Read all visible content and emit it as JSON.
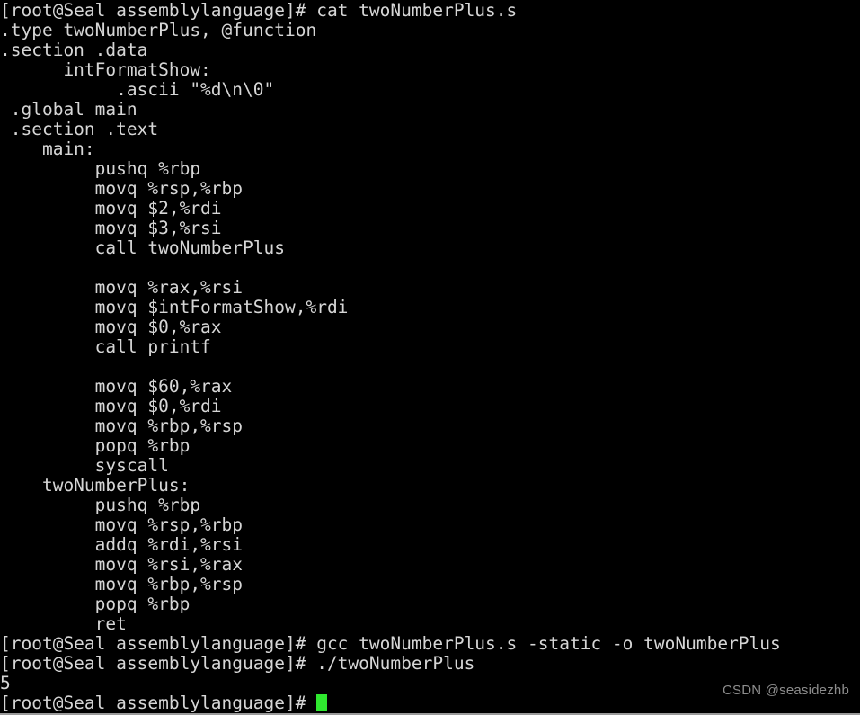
{
  "terminal": {
    "background_color": "#000000",
    "foreground_color": "#d6d6d6",
    "cursor_color": "#2fe82f",
    "prompt": "[root@Seal assemblylanguage]# ",
    "lines": [
      {
        "type": "prompt",
        "prompt": "[root@Seal assemblylanguage]# ",
        "command": "cat twoNumberPlus.s"
      },
      {
        "type": "output",
        "text": ".type twoNumberPlus, @function"
      },
      {
        "type": "output",
        "text": ".section .data"
      },
      {
        "type": "output",
        "text": "      intFormatShow:"
      },
      {
        "type": "output",
        "text": "           .ascii \"%d\\n\\0\""
      },
      {
        "type": "output",
        "text": " .global main"
      },
      {
        "type": "output",
        "text": " .section .text"
      },
      {
        "type": "output",
        "text": "    main:"
      },
      {
        "type": "output",
        "text": "         pushq %rbp"
      },
      {
        "type": "output",
        "text": "         movq %rsp,%rbp"
      },
      {
        "type": "output",
        "text": "         movq $2,%rdi"
      },
      {
        "type": "output",
        "text": "         movq $3,%rsi"
      },
      {
        "type": "output",
        "text": "         call twoNumberPlus"
      },
      {
        "type": "output",
        "text": ""
      },
      {
        "type": "output",
        "text": "         movq %rax,%rsi"
      },
      {
        "type": "output",
        "text": "         movq $intFormatShow,%rdi"
      },
      {
        "type": "output",
        "text": "         movq $0,%rax"
      },
      {
        "type": "output",
        "text": "         call printf"
      },
      {
        "type": "output",
        "text": ""
      },
      {
        "type": "output",
        "text": "         movq $60,%rax"
      },
      {
        "type": "output",
        "text": "         movq $0,%rdi"
      },
      {
        "type": "output",
        "text": "         movq %rbp,%rsp"
      },
      {
        "type": "output",
        "text": "         popq %rbp"
      },
      {
        "type": "output",
        "text": "         syscall"
      },
      {
        "type": "output",
        "text": "    twoNumberPlus:"
      },
      {
        "type": "output",
        "text": "         pushq %rbp"
      },
      {
        "type": "output",
        "text": "         movq %rsp,%rbp"
      },
      {
        "type": "output",
        "text": "         addq %rdi,%rsi"
      },
      {
        "type": "output",
        "text": "         movq %rsi,%rax"
      },
      {
        "type": "output",
        "text": "         movq %rbp,%rsp"
      },
      {
        "type": "output",
        "text": "         popq %rbp"
      },
      {
        "type": "output",
        "text": "         ret"
      },
      {
        "type": "prompt",
        "prompt": "[root@Seal assemblylanguage]# ",
        "command": "gcc twoNumberPlus.s -static -o twoNumberPlus"
      },
      {
        "type": "prompt",
        "prompt": "[root@Seal assemblylanguage]# ",
        "command": "./twoNumberPlus"
      },
      {
        "type": "output",
        "text": "5"
      },
      {
        "type": "prompt",
        "prompt": "[root@Seal assemblylanguage]# ",
        "command": "",
        "cursor": true
      }
    ]
  },
  "watermark": {
    "text": "CSDN @seasidezhb"
  }
}
